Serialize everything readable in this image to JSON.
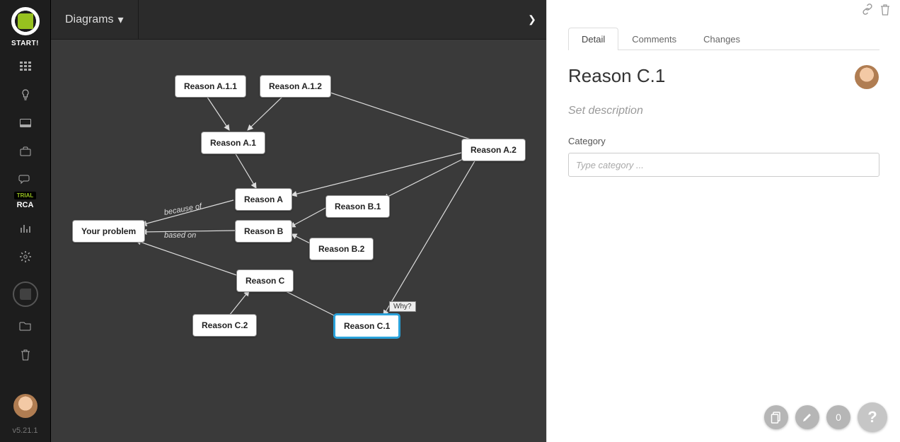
{
  "rail": {
    "start": "START!",
    "trial": "TRIAL",
    "rca": "RCA",
    "version": "v5.21.1",
    "icons": [
      "grid",
      "lightbulb",
      "card",
      "briefcase",
      "chat",
      "bars",
      "gear",
      "folder",
      "trash"
    ]
  },
  "topbar": {
    "tab_label": "Diagrams"
  },
  "canvas": {
    "nodes": {
      "your_problem": "Your problem",
      "reason_a": "Reason A",
      "reason_b": "Reason B",
      "reason_c": "Reason C",
      "reason_a1": "Reason A.1",
      "reason_a2": "Reason A.2",
      "reason_a11": "Reason A.1.1",
      "reason_a12": "Reason A.1.2",
      "reason_b1": "Reason B.1",
      "reason_b2": "Reason B.2",
      "reason_c1": "Reason C.1",
      "reason_c2": "Reason C.2"
    },
    "edge_labels": {
      "because_of": "because of",
      "based_on": "based on"
    },
    "why_tag": "Why?"
  },
  "panel": {
    "tabs": {
      "detail": "Detail",
      "comments": "Comments",
      "changes": "Changes"
    },
    "title": "Reason C.1",
    "description_placeholder": "Set description",
    "category_label": "Category",
    "category_placeholder": "Type category ..."
  },
  "fab": {
    "count": "0"
  }
}
